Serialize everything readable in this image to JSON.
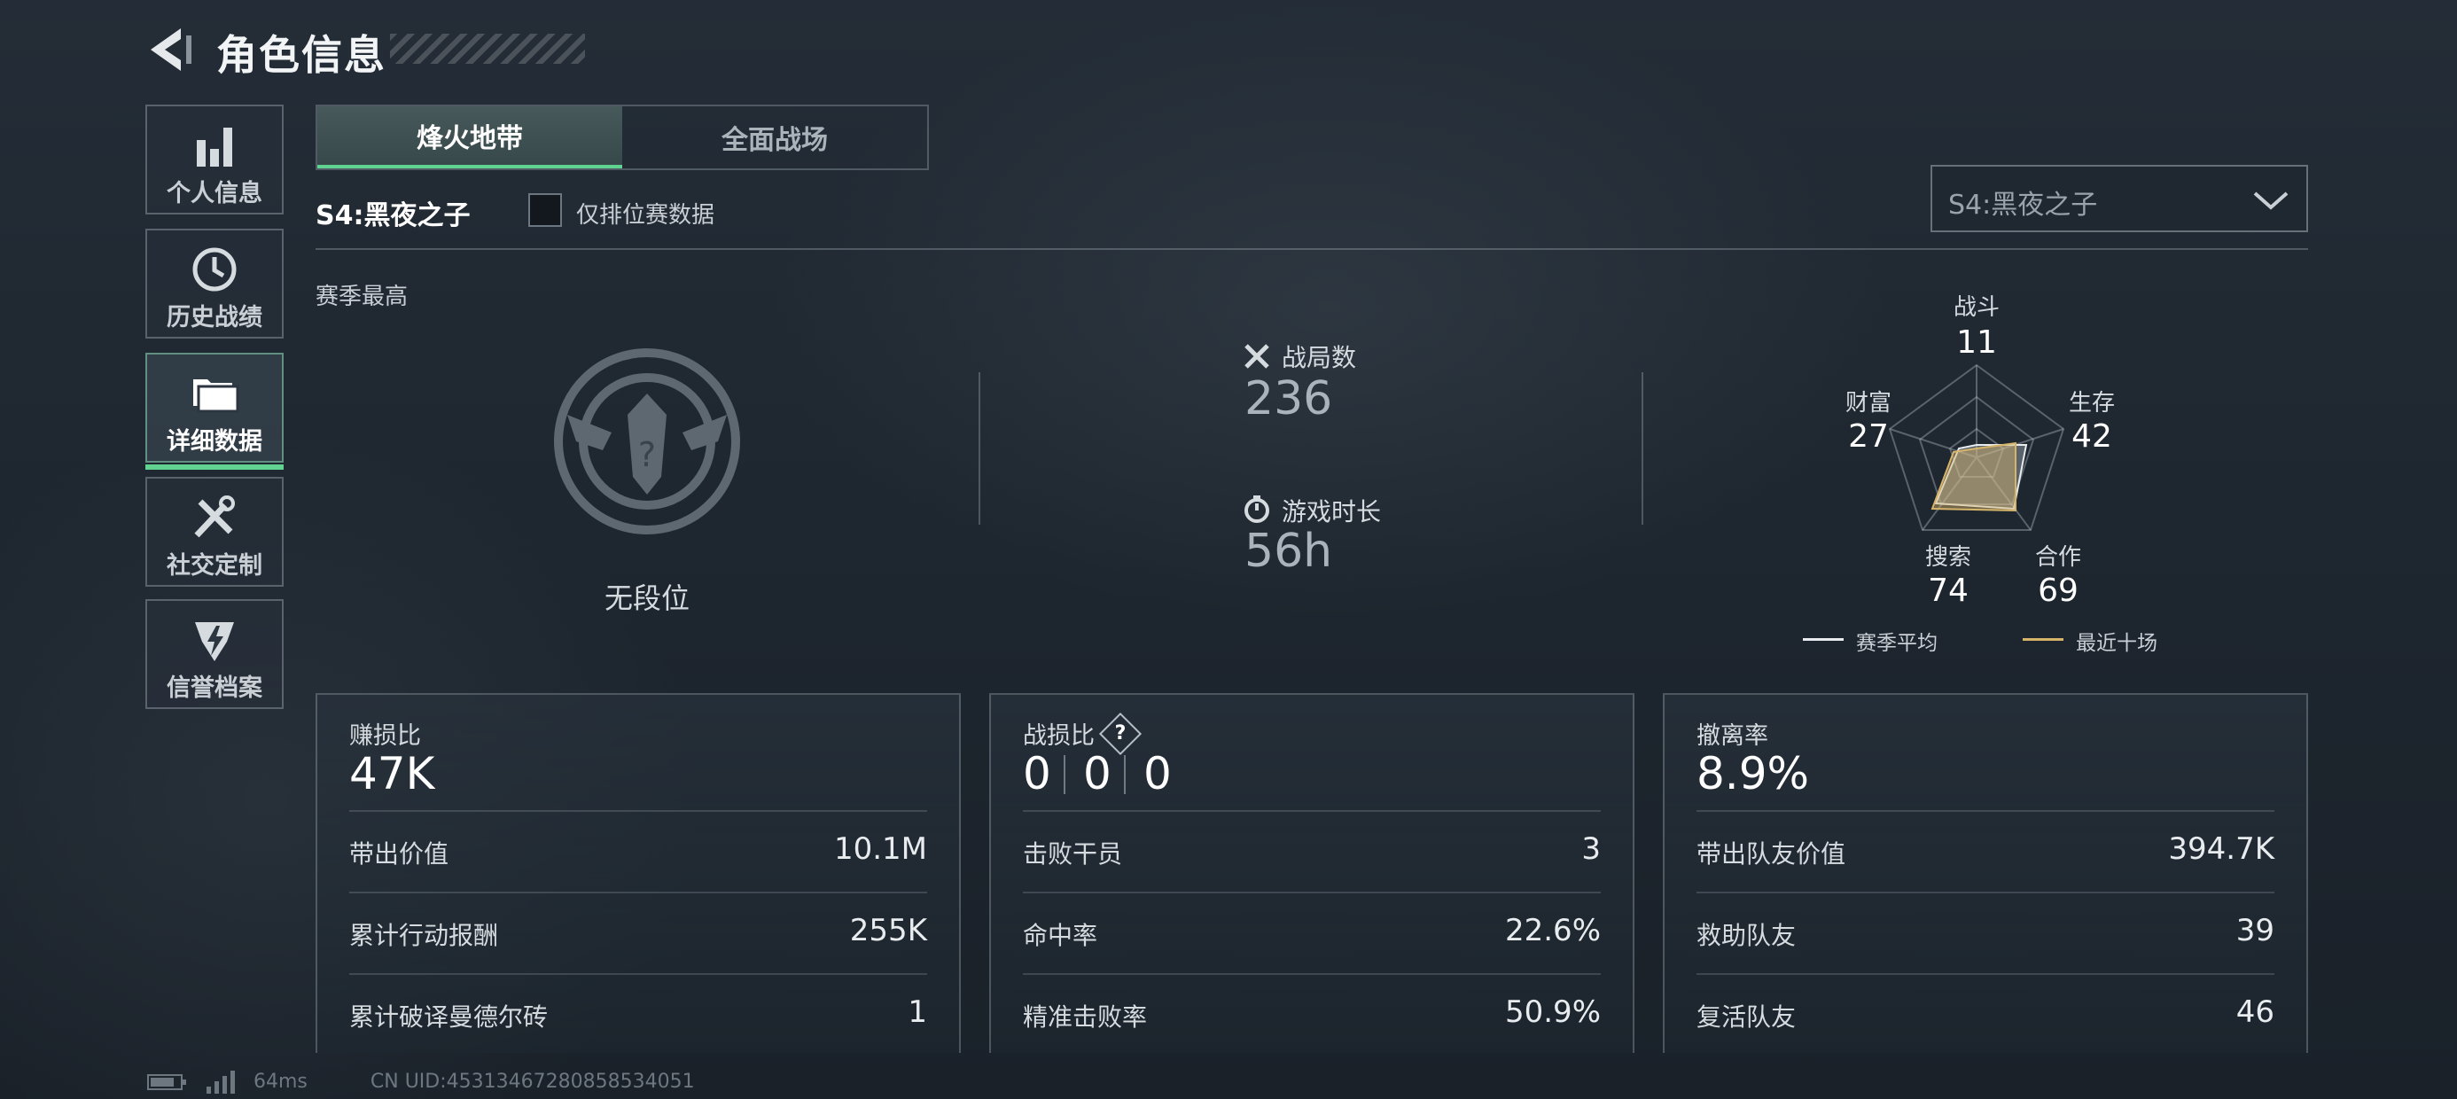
{
  "header": {
    "title": "角色信息"
  },
  "sidebar": {
    "items": [
      {
        "label": "个人信息",
        "icon": "bar-chart-icon",
        "active": false
      },
      {
        "label": "历史战绩",
        "icon": "clock-history-icon",
        "active": false
      },
      {
        "label": "详细数据",
        "icon": "folder-icon",
        "active": true
      },
      {
        "label": "社交定制",
        "icon": "tools-icon",
        "active": false
      },
      {
        "label": "信誉档案",
        "icon": "shield-bolt-icon",
        "active": false
      }
    ]
  },
  "tabs": [
    {
      "label": "烽火地带",
      "active": true
    },
    {
      "label": "全面战场",
      "active": false
    }
  ],
  "season": {
    "label": "S4:黑夜之子",
    "ranked_only_label": "仅排位赛数据",
    "ranked_only_checked": false,
    "select_value": "S4:黑夜之子"
  },
  "season_best": {
    "label": "赛季最高",
    "rank_text": "无段位"
  },
  "matches": {
    "label": "战局数",
    "value": "236"
  },
  "playtime": {
    "label": "游戏时长",
    "value": "56h"
  },
  "radar": {
    "axes": [
      {
        "label": "战斗",
        "value": "11"
      },
      {
        "label": "生存",
        "value": "42"
      },
      {
        "label": "合作",
        "value": "69"
      },
      {
        "label": "搜索",
        "value": "74"
      },
      {
        "label": "财富",
        "value": "27"
      }
    ],
    "legend": {
      "season_avg": "赛季平均",
      "recent_ten": "最近十场"
    },
    "colors": {
      "season_avg": "#e8ecef",
      "recent_ten": "#d6b56a"
    }
  },
  "cards": {
    "profit": {
      "title": "赚损比",
      "value": "47K",
      "rows": [
        {
          "k": "带出价值",
          "v": "10.1M"
        },
        {
          "k": "累计行动报酬",
          "v": "255K"
        },
        {
          "k": "累计破译曼德尔砖",
          "v": "1"
        }
      ]
    },
    "kd": {
      "title": "战损比",
      "help": "?",
      "values": [
        "0",
        "0",
        "0"
      ],
      "rows": [
        {
          "k": "击败干员",
          "v": "3"
        },
        {
          "k": "命中率",
          "v": "22.6%"
        },
        {
          "k": "精准击败率",
          "v": "50.9%"
        }
      ]
    },
    "extract": {
      "title": "撤离率",
      "value": "8.9%",
      "rows": [
        {
          "k": "带出队友价值",
          "v": "394.7K"
        },
        {
          "k": "救助队友",
          "v": "39"
        },
        {
          "k": "复活队友",
          "v": "46"
        }
      ]
    }
  },
  "footer": {
    "ping": "64ms",
    "uid": "CN UID:45313467280858534051"
  },
  "accent": "#5fd38f"
}
